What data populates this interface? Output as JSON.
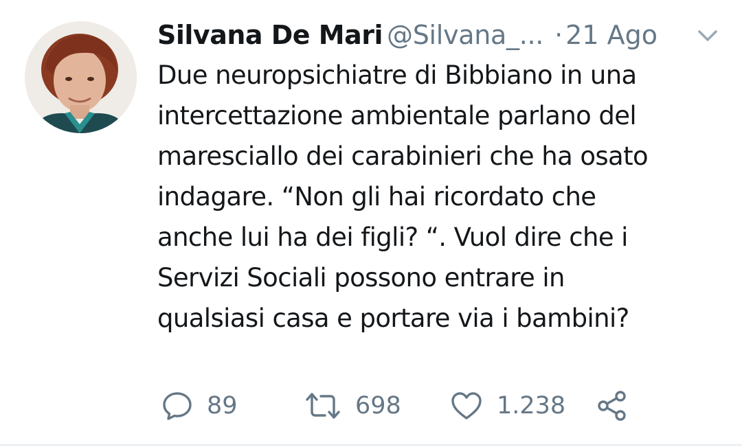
{
  "tweet": {
    "author_name": "Silvana De Mari",
    "handle": "@Silvana_...",
    "separator": "·",
    "date": "21 Ago",
    "text_lines": [
      "Due neuropsichiatre di Bibbiano in una",
      "intercettazione ambientale parlano del",
      "maresciallo dei carabinieri che ha osato",
      "indagare. “Non gli hai ricordato che",
      "anche lui ha dei figli? “. Vuol dire che i",
      "Servizi Sociali possono entrare in",
      "qualsiasi casa e portare via i bambini?"
    ],
    "replies": "89",
    "retweets": "698",
    "likes": "1.238"
  },
  "icons": {
    "reply": "speech-bubble-icon",
    "retweet": "retweet-arrows-icon",
    "like": "heart-icon",
    "share": "share-icon",
    "caret": "chevron-down-icon"
  },
  "colors": {
    "text": "#14171a",
    "secondary": "#657786",
    "divider": "#e6ecf0"
  }
}
